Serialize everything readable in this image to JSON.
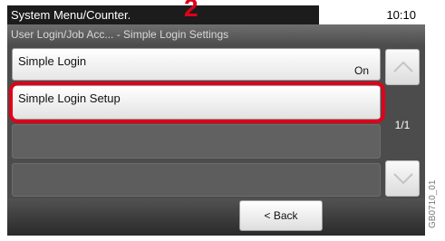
{
  "header": {
    "menu_title": "System Menu/Counter.",
    "clock": "10:10"
  },
  "breadcrumb": "User Login/Job Acc... - Simple Login Settings",
  "list": {
    "items": [
      {
        "label": "Simple Login",
        "value": "On"
      },
      {
        "label": "Simple Login Setup"
      }
    ]
  },
  "annotation": {
    "step_number": "2"
  },
  "scroll": {
    "page_indicator": "1/1",
    "up_icon": "chevron-up-icon",
    "down_icon": "chevron-down-icon"
  },
  "footer": {
    "back_label": "< Back"
  },
  "figure_id": "GB0710_01",
  "colors": {
    "highlight": "#e0001a",
    "panel_background": "#3a3a3a",
    "title_bar": "#1c1c1c"
  }
}
